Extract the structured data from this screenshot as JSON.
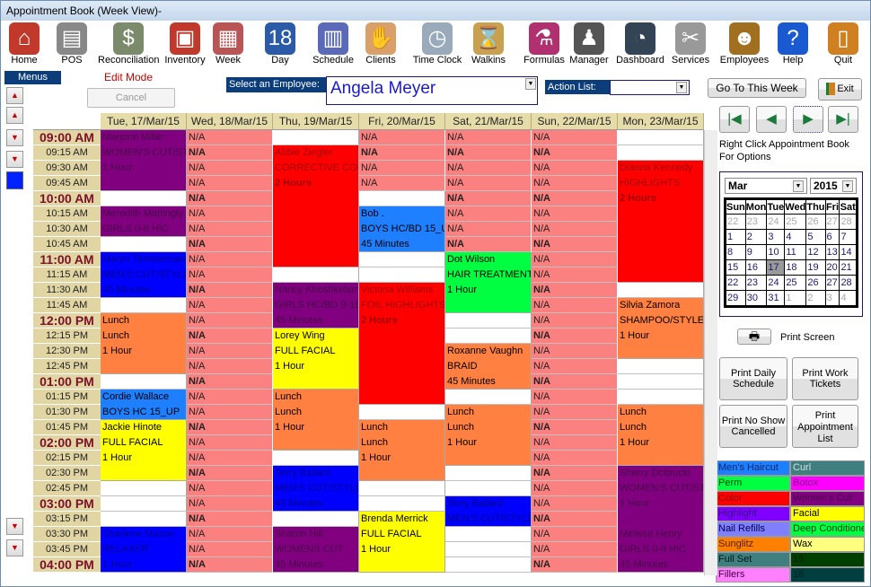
{
  "window": {
    "title": "Appointment Book (Week View)-"
  },
  "toolbar": [
    {
      "label": "Home",
      "icon": "house-icon",
      "color": "#c0392b",
      "glyph": "⌂"
    },
    {
      "label": "POS",
      "icon": "cash-register-icon",
      "color": "#888",
      "glyph": "▤"
    },
    {
      "label": "Reconciliation",
      "icon": "money-icon",
      "color": "#7a8a6a",
      "glyph": "$"
    },
    {
      "label": "Inventory",
      "icon": "box-icon",
      "color": "#c0392b",
      "glyph": "▣"
    },
    {
      "label": "Week",
      "icon": "week-calendar-icon",
      "color": "#b55",
      "glyph": "▦"
    },
    {
      "label": "Day",
      "icon": "day-calendar-icon",
      "color": "#2a5aa8",
      "glyph": "18"
    },
    {
      "label": "Schedule",
      "icon": "schedule-icon",
      "color": "#5a6ab8",
      "glyph": "▥"
    },
    {
      "label": "Clients",
      "icon": "handshake-icon",
      "color": "#d9a06a",
      "glyph": "✋"
    },
    {
      "label": "Time Clock",
      "icon": "stopwatch-icon",
      "color": "#9ab",
      "glyph": "◷"
    },
    {
      "label": "Walkins",
      "icon": "hourglass-icon",
      "color": "#c8a050",
      "glyph": "⌛"
    },
    {
      "label": "Formulas",
      "icon": "flask-icon",
      "color": "#b03070",
      "glyph": "⚗"
    },
    {
      "label": "Manager",
      "icon": "manager-icon",
      "color": "#555",
      "glyph": "♟"
    },
    {
      "label": "Dashboard",
      "icon": "gauge-icon",
      "color": "#345",
      "glyph": "◔"
    },
    {
      "label": "Services",
      "icon": "scissors-icon",
      "color": "#999",
      "glyph": "✂"
    },
    {
      "label": "Employees",
      "icon": "people-icon",
      "color": "#a07020",
      "glyph": "☻"
    },
    {
      "label": "Help",
      "icon": "help-icon",
      "color": "#1a5ad0",
      "glyph": "?"
    },
    {
      "label": "Quit",
      "icon": "door-exit-icon",
      "color": "#d08020",
      "glyph": "▯"
    }
  ],
  "menus_label": "Menus",
  "edit_mode": "Edit Mode",
  "cancel_label": "Cancel",
  "employee": {
    "label": "Select an Employee:",
    "value": "Angela Meyer"
  },
  "action_list": {
    "label": "Action List:",
    "value": ""
  },
  "go_to_week": "Go To This Week",
  "exit_label": "Exit",
  "hint": "Right Click Appointment Book For Options",
  "calendar": {
    "month": "Mar",
    "year": "2015",
    "weekdays": [
      "Sun",
      "Mon",
      "Tue",
      "Wed",
      "Thu",
      "Fri",
      "Sat"
    ],
    "weeks": [
      [
        "22",
        "23",
        "24",
        "25",
        "26",
        "27",
        "28"
      ],
      [
        "1",
        "2",
        "3",
        "4",
        "5",
        "6",
        "7"
      ],
      [
        "8",
        "9",
        "10",
        "11",
        "12",
        "13",
        "14"
      ],
      [
        "15",
        "16",
        "17",
        "18",
        "19",
        "20",
        "21"
      ],
      [
        "22",
        "23",
        "24",
        "25",
        "26",
        "27",
        "28"
      ],
      [
        "29",
        "30",
        "31",
        "1",
        "2",
        "3",
        "4"
      ]
    ],
    "selected": "17"
  },
  "print_screen": "Print Screen",
  "print_buttons": [
    "Print Daily Schedule",
    "Print Work Tickets",
    "Print No Show Cancelled",
    "Print Appointment List"
  ],
  "legend": [
    {
      "label": "Men's Haircut",
      "bg": "#1e7fff",
      "fg": "#0a2a70"
    },
    {
      "label": "Curl",
      "bg": "#3f7f7f",
      "fg": "#d0e0e0"
    },
    {
      "label": "Perm",
      "bg": "#00ff40",
      "fg": "#004010"
    },
    {
      "label": "Botox",
      "bg": "#ff00ff",
      "fg": "#800080"
    },
    {
      "label": "Color",
      "bg": "#ff0000",
      "fg": "#900000"
    },
    {
      "label": "Women's Cut",
      "bg": "#800080",
      "fg": "#4a004a"
    },
    {
      "label": "Highlight",
      "bg": "#7f00ff",
      "fg": "#3a0080"
    },
    {
      "label": "Facial",
      "bg": "#ffff00",
      "fg": "#000"
    },
    {
      "label": "Nail Refills",
      "bg": "#8080ff",
      "fg": "#000050"
    },
    {
      "label": "Deep Conditione",
      "bg": "#00ff40",
      "fg": "#004010"
    },
    {
      "label": "Sunglitz",
      "bg": "#ff8000",
      "fg": "#502000"
    },
    {
      "label": "Wax",
      "bg": "#ffff80",
      "fg": "#000"
    },
    {
      "label": "Full Set",
      "bg": "#3f7f7f",
      "fg": "#001818"
    },
    {
      "label": "15",
      "bg": "#003f00",
      "fg": "#002000"
    },
    {
      "label": "Fillers",
      "bg": "#ff80ff",
      "fg": "#400040"
    },
    {
      "label": "16",
      "bg": "#003f3f",
      "fg": "#002020"
    }
  ],
  "days": [
    "Tue, 17/Mar/15",
    "Wed, 18/Mar/15",
    "Thu, 19/Mar/15",
    "Fri, 20/Mar/15",
    "Sat, 21/Mar/15",
    "Sun, 22/Mar/15",
    "Mon, 23/Mar/15"
  ],
  "time_slots": [
    "09:00 AM",
    "09:15 AM",
    "09:30 AM",
    "09:45 AM",
    "10:00 AM",
    "10:15 AM",
    "10:30 AM",
    "10:45 AM",
    "11:00 AM",
    "11:15 AM",
    "11:30 AM",
    "11:45 AM",
    "12:00 PM",
    "12:15 PM",
    "12:30 PM",
    "12:45 PM",
    "01:00 PM",
    "01:15 PM",
    "01:30 PM",
    "01:45 PM",
    "02:00 PM",
    "02:15 PM",
    "02:30 PM",
    "02:45 PM",
    "03:00 PM",
    "03:15 PM",
    "03:30 PM",
    "03:45 PM",
    "04:00 PM"
  ],
  "na_label": "N/A",
  "colors": {
    "purple": "#800080",
    "purple_text": "#4a004a",
    "blue": "#0000ff",
    "blue_text": "#00008a",
    "red": "#ff0000",
    "red_text": "#a00000",
    "orange": "#ff8040",
    "yellow": "#ffff00",
    "lightblue": "#1e7fff",
    "green": "#00ff40",
    "na": "#fb8080"
  },
  "schedule": [
    {
      "na": [],
      "appts": [
        {
          "slot": 0,
          "span": 4,
          "color": "purple",
          "lines": [
            "Marjorie Miller",
            "WOMEN'S CUT/STY",
            "1 Hour"
          ]
        },
        {
          "slot": 5,
          "span": 2,
          "color": "purple",
          "lines": [
            "Meredith Mattingly",
            "GIRLS 0-8 H\\C"
          ]
        },
        {
          "slot": 8,
          "span": 3,
          "color": "blue",
          "lines": [
            "Maryn Timmermans",
            "MEN'S CUT/STYLE",
            "45 Minutes"
          ]
        },
        {
          "slot": 12,
          "span": 4,
          "color": "orange",
          "lines": [
            "Lunch",
            "Lunch",
            "1 Hour"
          ]
        },
        {
          "slot": 17,
          "span": 2,
          "color": "lightblue",
          "lines": [
            "Cordie Wallace",
            "BOYS HC 15_UP"
          ]
        },
        {
          "slot": 19,
          "span": 4,
          "color": "yellow",
          "lines": [
            "Jackie Hinote",
            "FULL FACIAL",
            "1 Hour"
          ]
        },
        {
          "slot": 26,
          "span": 3,
          "color": "blue",
          "lines": [
            "Sharlene Mason",
            "RELAXER",
            "1 Hour"
          ]
        }
      ]
    },
    {
      "na": [
        0,
        1,
        2,
        3,
        4,
        5,
        6,
        7,
        8,
        9,
        10,
        11,
        12,
        13,
        14,
        15,
        16,
        17,
        18,
        19,
        20,
        21,
        22,
        23,
        24,
        25,
        26,
        27,
        28
      ],
      "appts": []
    },
    {
      "na": [],
      "appts": [
        {
          "slot": 1,
          "span": 8,
          "color": "red",
          "lines": [
            "Abbie Ziegler",
            "CORRECTIVE COLO",
            "2 Hours"
          ]
        },
        {
          "slot": 10,
          "span": 3,
          "color": "purple",
          "lines": [
            "Nancy Khoshkelam",
            "GIRLS HC/BD 9-15",
            "45 Minutes"
          ]
        },
        {
          "slot": 13,
          "span": 4,
          "color": "yellow",
          "lines": [
            "Lorey Wing",
            "FULL FACIAL",
            "1 Hour"
          ]
        },
        {
          "slot": 17,
          "span": 4,
          "color": "orange",
          "lines": [
            "Lunch",
            "Lunch",
            "1 Hour"
          ]
        },
        {
          "slot": 22,
          "span": 3,
          "color": "blue",
          "lines": [
            "Terry Ballard",
            "MEN'S CUT/STYLE",
            "45 Minutes"
          ]
        },
        {
          "slot": 26,
          "span": 3,
          "color": "purple",
          "lines": [
            "Sharon Hill",
            "WOMENS CUT",
            "45 Minutes"
          ]
        }
      ]
    },
    {
      "na": [
        0,
        1,
        2,
        3
      ],
      "appts": [
        {
          "slot": 5,
          "span": 3,
          "color": "lightblue",
          "lines": [
            "Bob .",
            "BOYS HC/BD 15_U",
            "45 Minutes"
          ]
        },
        {
          "slot": 10,
          "span": 8,
          "color": "red",
          "lines": [
            "Victoria Williams",
            "FOIL HIGHLIGHTS",
            "2 Hours"
          ]
        },
        {
          "slot": 19,
          "span": 4,
          "color": "orange",
          "lines": [
            "Lunch",
            "Lunch",
            "1 Hour"
          ]
        },
        {
          "slot": 25,
          "span": 4,
          "color": "yellow",
          "lines": [
            "Brenda Merrick",
            "FULL FACIAL",
            "1 Hour"
          ]
        }
      ]
    },
    {
      "na": [
        0,
        1,
        2,
        3,
        4,
        5,
        6,
        7
      ],
      "appts": [
        {
          "slot": 8,
          "span": 4,
          "color": "green",
          "lines": [
            "Dot Wilson",
            "HAIR TREATMENT",
            "1 Hour"
          ]
        },
        {
          "slot": 14,
          "span": 3,
          "color": "orange",
          "lines": [
            "Roxanne Vaughn",
            "BRAID",
            "45 Minutes"
          ]
        },
        {
          "slot": 18,
          "span": 4,
          "color": "orange",
          "lines": [
            "Lunch",
            "Lunch",
            "1 Hour"
          ]
        },
        {
          "slot": 24,
          "span": 2,
          "color": "blue",
          "lines": [
            "Terry Ballard",
            "MEN'S CUT/STYLE"
          ]
        }
      ]
    },
    {
      "na": [
        0,
        1,
        2,
        3,
        4,
        5,
        6,
        7,
        8,
        9,
        10,
        11,
        12,
        13,
        14,
        15,
        16,
        17,
        18,
        19,
        20,
        21,
        22,
        23,
        24,
        25,
        26,
        27,
        28
      ],
      "appts": []
    },
    {
      "na": [],
      "appts": [
        {
          "slot": 2,
          "span": 8,
          "color": "red",
          "lines": [
            "Dianna Kennedy",
            "HIGHLIGHTS",
            "2 Hours"
          ]
        },
        {
          "slot": 11,
          "span": 4,
          "color": "orange",
          "lines": [
            "Silvia Zamora",
            "SHAMPOO/STYLE",
            "1 Hour"
          ]
        },
        {
          "slot": 18,
          "span": 4,
          "color": "orange",
          "lines": [
            "Lunch",
            "Lunch",
            "1 Hour"
          ]
        },
        {
          "slot": 22,
          "span": 7,
          "color": "purple",
          "lines": [
            "Sherry Dobrucki",
            "WOMEN'S CUT/ST",
            "1 Hour",
            "",
            "Melissa Henry",
            "GIRLS 0-8 H\\C",
            "45 Minutes"
          ]
        }
      ]
    }
  ]
}
